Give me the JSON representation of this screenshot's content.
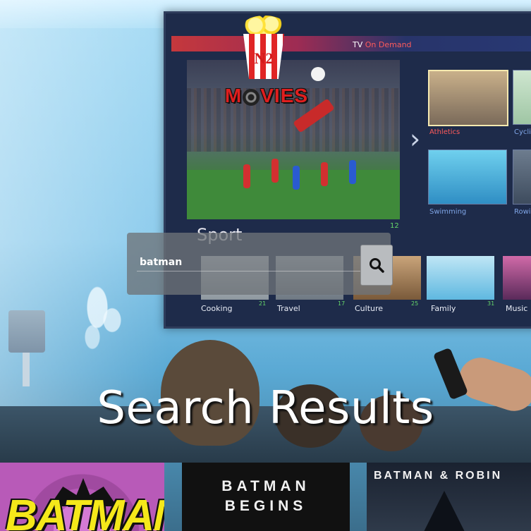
{
  "logo": {
    "line1": "N2",
    "line2_a": "M",
    "line2_b": "VIES"
  },
  "tv": {
    "brand_a": "TV ",
    "brand_b": "On Demand",
    "hero_title": "Sport",
    "hero_count": "12",
    "tiles": [
      {
        "label": "Athletics",
        "state": "highlighted"
      },
      {
        "label": "Cycli"
      },
      {
        "label": "Swimming"
      },
      {
        "label": "Rowi"
      }
    ],
    "row": [
      {
        "label": "Cooking",
        "count": "21"
      },
      {
        "label": "Travel",
        "count": "17"
      },
      {
        "label": "Culture",
        "count": "25"
      },
      {
        "label": "Family",
        "count": "31"
      },
      {
        "label": "Music",
        "count": ""
      }
    ]
  },
  "search": {
    "value": "batman",
    "button_icon": "search-icon"
  },
  "results": {
    "title": "Search Results",
    "posters": [
      {
        "title": "BATMAN",
        "accent": "#f5e81a",
        "bg": "#b85ab8"
      },
      {
        "title_line1": "BATMAN",
        "title_line2": "BEGINS",
        "bg": "#111111"
      },
      {
        "title": "BATMAN & ROBIN",
        "bg": "#1a2230"
      }
    ]
  }
}
